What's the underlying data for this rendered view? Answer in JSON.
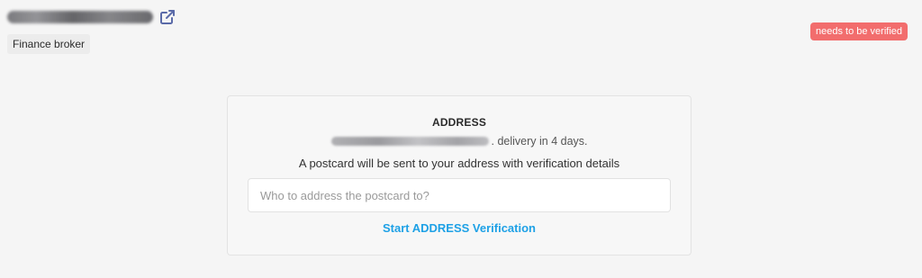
{
  "header": {
    "category": "Finance broker",
    "status_badge": "needs to be verified",
    "external_link_icon": "external-link-icon"
  },
  "card": {
    "title": "ADDRESS",
    "delivery_text": ". delivery in 4 days.",
    "instruction": "A postcard will be sent to your address with verification details",
    "input": {
      "value": "",
      "placeholder": "Who to address the postcard to?"
    },
    "start_button_label": "Start ADDRESS Verification"
  },
  "colors": {
    "badge_background": "#f26d6d",
    "link_accent": "#1ea1e6",
    "icon_color": "#5a6aa8"
  }
}
